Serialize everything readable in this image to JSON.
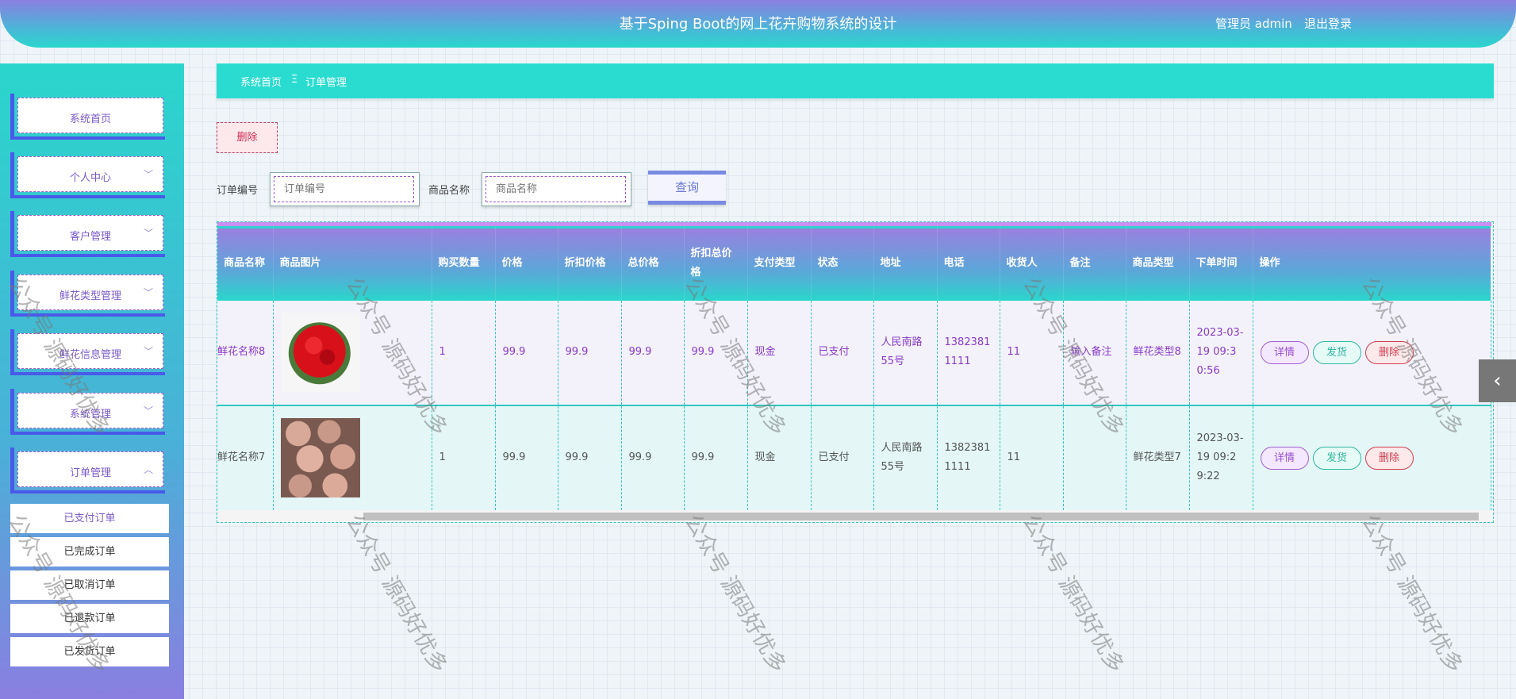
{
  "header": {
    "title": "基于Sping Boot的网上花卉购物系统的设计",
    "user": "管理员 admin",
    "logout": "退出登录"
  },
  "sidebar": {
    "menus": [
      {
        "label": "系统首页",
        "chevron": ""
      },
      {
        "label": "个人中心",
        "chevron": "﹀"
      },
      {
        "label": "客户管理",
        "chevron": "﹀"
      },
      {
        "label": "鲜花类型管理",
        "chevron": "﹀"
      },
      {
        "label": "鲜花信息管理",
        "chevron": "﹀"
      },
      {
        "label": "系统管理",
        "chevron": "﹀"
      },
      {
        "label": "订单管理",
        "chevron": "︿"
      }
    ],
    "submenus": [
      "已支付订单",
      "已完成订单",
      "已取消订单",
      "已退款订单",
      "已发货订单"
    ]
  },
  "breadcrumb": {
    "home": "系统首页",
    "sep": "Ξ",
    "current": "订单管理"
  },
  "toolbar": {
    "delete": "删除"
  },
  "search": {
    "order_label": "订单编号",
    "order_placeholder": "订单编号",
    "name_label": "商品名称",
    "name_placeholder": "商品名称",
    "button": "查询"
  },
  "table": {
    "headers": [
      "商品名称",
      "商品图片",
      "购买数量",
      "价格",
      "折扣价格",
      "总价格",
      "折扣总价格",
      "支付类型",
      "状态",
      "地址",
      "电话",
      "收货人",
      "备注",
      "商品类型",
      "下单时间",
      "操作"
    ],
    "rows": [
      {
        "name": "鲜花名称8",
        "qty": "1",
        "price": "99.9",
        "discount": "99.9",
        "total": "99.9",
        "discount_total": "99.9",
        "pay": "现金",
        "status": "已支付",
        "address": "人民南路55号",
        "phone": "13823811111",
        "receiver": "11",
        "remark": "输入备注",
        "type": "鲜花类型8",
        "time": "2023-03-19 09:30:56",
        "image": "red-roses"
      },
      {
        "name": "鲜花名称7",
        "qty": "1",
        "price": "99.9",
        "discount": "99.9",
        "total": "99.9",
        "discount_total": "99.9",
        "pay": "现金",
        "status": "已支付",
        "address": "人民南路55号",
        "phone": "13823811111",
        "receiver": "11",
        "remark": "",
        "type": "鲜花类型7",
        "time": "2023-03-19 09:29:22",
        "image": "pink-roses"
      }
    ],
    "actions": {
      "detail": "详情",
      "ship": "发货",
      "delete": "删除"
    }
  },
  "side_tab": "‹",
  "watermark": "公众号 源码好优多",
  "colors": {
    "accent": "#2adcd0",
    "purple": "#8a7fe0",
    "danger": "#d04050"
  }
}
